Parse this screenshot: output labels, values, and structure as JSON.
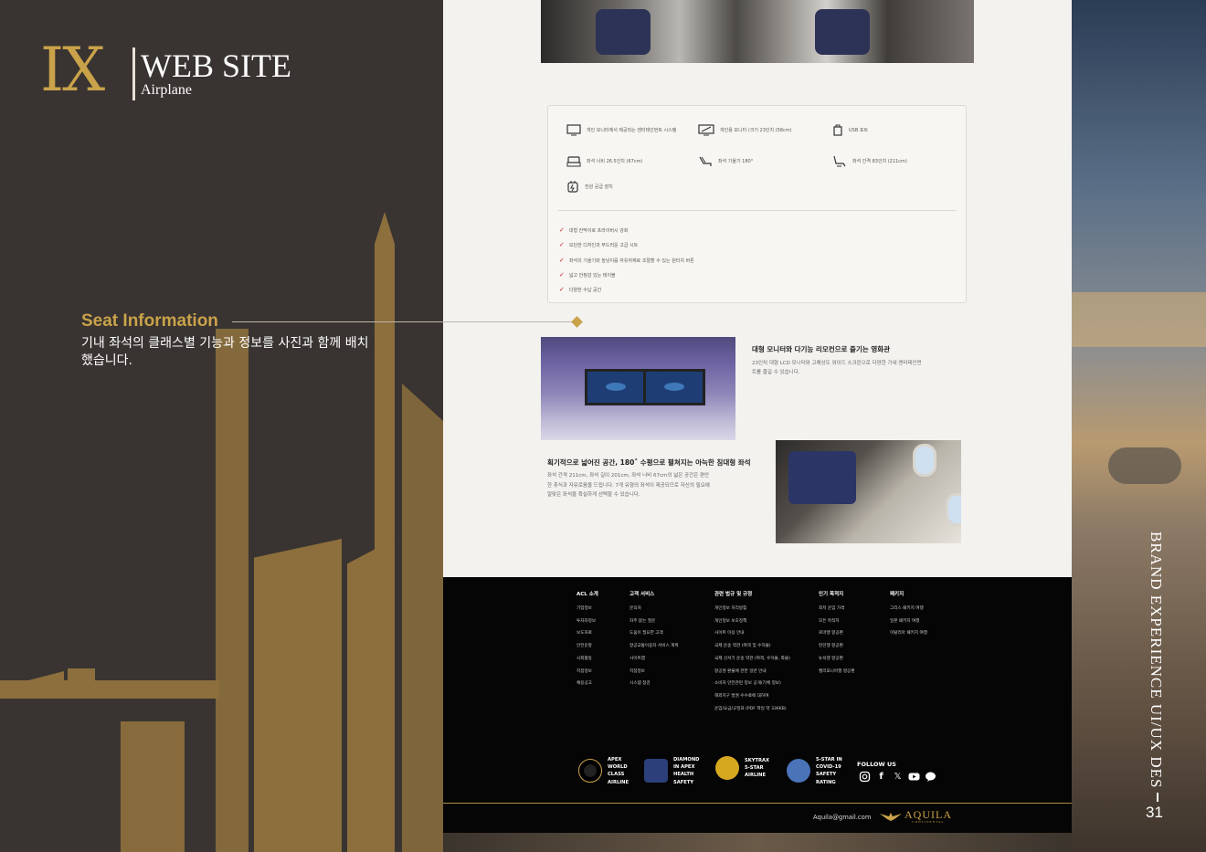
{
  "header": {
    "logo_mark": "IX",
    "title": "WEB SITE",
    "subtitle": "Airplane"
  },
  "section": {
    "title": "Seat Information",
    "description": "기내 좌석의 클래스별 기능과 정보를 사진과 함께 배치했습니다."
  },
  "side": {
    "vertical_text": "BRAND EXPERIENCE UI/UX DES",
    "page_number": "31"
  },
  "features": [
    {
      "icon": "monitor-icon",
      "label": "개인 모니터에서 제공되는 엔터테인먼트 시스템"
    },
    {
      "icon": "screen-icon",
      "label": "개인용 모니터 (크기 23인치 (58cm)"
    },
    {
      "icon": "usb-icon",
      "label": "USB 포트"
    },
    {
      "icon": "seat-width-icon",
      "label": "좌석 너비 26.5인치 (67cm)"
    },
    {
      "icon": "recline-icon",
      "label": "좌석 기울기 180°"
    },
    {
      "icon": "seat-pitch-icon",
      "label": "좌석 간격 83인치 (211cm)"
    },
    {
      "icon": "power-icon",
      "label": "전원 공급 장치"
    }
  ],
  "checklist": [
    "대형 칸막이로 프라이버시 강화",
    "모던한 디자인과 부드러운 고급 시트",
    "좌석의 기울기와 높낮이를 자유자재로 조절할 수 있는 원터치 버튼",
    "넓고 안정감 있는 테이블",
    "다양한 수납 공간"
  ],
  "content": {
    "block1_title": "대형 모니터와 다기능 리모컨으로 즐기는 영화관",
    "block1_body": "23인치 대형 LCD 모니터와 고해상도 와이드 스크린으로 다양한 기내 엔터테인먼트를 즐길 수 있습니다.",
    "block2_title": "획기적으로 넓어진 공간, 180˚ 수평으로 펼쳐지는 아늑한 침대형 좌석",
    "block2_body": "좌석 간격 211cm, 좌석 길이 201cm, 좌석 너비 67cm의 넓은 공간은 편안한 휴식과 자유로움을 드립니다. 7개 유형의 좌석이 제공되므로 자신의 필요에 알맞은 좌석을 확실하게 선택할 수 있습니다."
  },
  "footer": {
    "columns": [
      {
        "title": "ACL 소개",
        "items": [
          "기업정보",
          "투자자정보",
          "보도자료",
          "안전운항",
          "사회활동",
          "지점정보",
          "채용공고"
        ]
      },
      {
        "title": "고객 서비스",
        "items": [
          "문의처",
          "자주 묻는 질문",
          "도움이 필요한 고객",
          "항공교통이용자 서비스 계획",
          "사이트맵",
          "지점정보",
          "시스템 점검"
        ]
      },
      {
        "title": "관련 법규 및 규정",
        "items": [
          "개인정보 처리방침",
          "개인정보 보호정책",
          "사이트 이용 안내",
          "국제 운송 약관 (여객 및 수하물)",
          "국제 선서기 운송 약관 (여객, 수하물, 화물)",
          "항공권 환불에 관한 일반 안내",
          "소비자 안전관련 정보 공개(기체 정보)",
          "해외지구 발권 수수료에 대하여",
          "운임/요금/규정표 (PDF 파일 약 336KB)"
        ]
      },
      {
        "title": "인기 목적지",
        "items": [
          "최저 운임 가격",
          "모든 목적지",
          "로마행 항공편",
          "런던행 항공편",
          "뉴욕행 항공편",
          "캘리포니아행 항공편"
        ]
      },
      {
        "title": "패키지",
        "items": [
          "그리스 패키지 여행",
          "일본 패키지 여행",
          "이탈리아 패키지 여행"
        ]
      }
    ],
    "awards": [
      {
        "text": [
          "APEX",
          "WORLD",
          "CLASS",
          "AIRLINE"
        ],
        "color": "#c9a24a"
      },
      {
        "text": [
          "DIAMOND",
          "IN APEX",
          "HEALTH",
          "SAFETY"
        ],
        "color": "#2c3f7a"
      },
      {
        "text": [
          "SKYTRAX",
          "5-STAR",
          "AIRLINE"
        ],
        "color": "#d6a820"
      },
      {
        "text": [
          "5-STAR IN",
          "COVID-19",
          "SAFETY",
          "RATING"
        ],
        "color": "#4a73b8"
      }
    ],
    "follow_label": "FOLLOW US",
    "social_icons": [
      "instagram-icon",
      "facebook-icon",
      "x-icon",
      "youtube-icon",
      "chat-icon"
    ],
    "email": "Aquila@gmail.com",
    "brand": "AQUILA",
    "brand_sub": "CONTINENTAL"
  },
  "colors": {
    "gold": "#c9a24a",
    "panel": "#393431",
    "footer_bg": "#050505",
    "check_red": "#c8202d"
  }
}
